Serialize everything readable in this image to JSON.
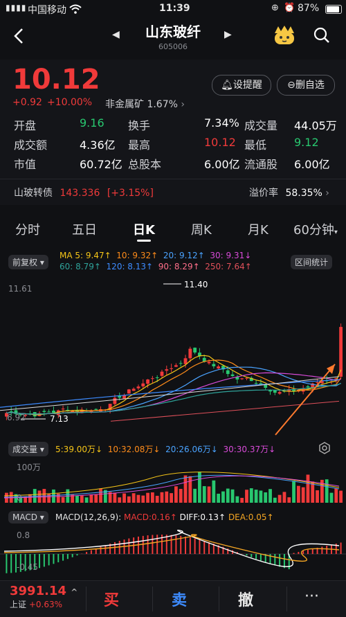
{
  "status": {
    "carrier": "中国移动",
    "time": "11:39",
    "battery": "87%"
  },
  "nav": {
    "title": "山东玻纤",
    "code": "605006"
  },
  "quote": {
    "price": "10.12",
    "change": "+0.92",
    "change_pct": "+10.00%",
    "sector": "非金属矿",
    "sector_pct": "1.67%",
    "alert_label": "设提醒",
    "watch_label": "删自选",
    "rows": [
      [
        {
          "k": "开盘",
          "v": "9.16",
          "c": "green"
        },
        {
          "k": "换手",
          "v": "7.34%",
          "c": "white"
        },
        {
          "k": "成交量",
          "v": "44.05万",
          "c": "white"
        }
      ],
      [
        {
          "k": "成交额",
          "v": "4.36亿",
          "c": "white"
        },
        {
          "k": "最高",
          "v": "10.12",
          "c": "red"
        },
        {
          "k": "最低",
          "v": "9.12",
          "c": "green"
        }
      ],
      [
        {
          "k": "市值",
          "v": "60.72亿",
          "c": "white"
        },
        {
          "k": "总股本",
          "v": "6.00亿",
          "c": "white"
        },
        {
          "k": "流通股",
          "v": "6.00亿",
          "c": "white"
        }
      ]
    ],
    "bond_name": "山玻转债",
    "bond_price": "143.336",
    "bond_pct": "[+3.15%]",
    "premium_label": "溢价率",
    "premium_value": "58.35%"
  },
  "tabs": [
    "分时",
    "五日",
    "日K",
    "周K",
    "月K",
    "60分钟"
  ],
  "kline": {
    "adjust_label": "前复权",
    "stats_label": "区间统计",
    "ma": [
      {
        "t": "MA 5: 9.47↑",
        "color": "#f5c518"
      },
      {
        "t": "10: 9.32↑",
        "color": "#ff8c1a"
      },
      {
        "t": "20: 9.12↑",
        "color": "#4aa3ff"
      },
      {
        "t": "30: 9.31↓",
        "color": "#d94bd9"
      },
      {
        "t": "60: 8.79↑",
        "color": "#2fa39a"
      },
      {
        "t": "120: 8.13↑",
        "color": "#3d8bff"
      },
      {
        "t": "90: 8.29↑",
        "color": "#ff6f8a"
      },
      {
        "t": "250: 7.64↑",
        "color": "#e0505a"
      }
    ],
    "axis_top": "11.61",
    "axis_bottom": "6.92",
    "high_label": "11.40",
    "low_label": "7.13"
  },
  "volume": {
    "label": "成交量",
    "ma": [
      {
        "t": "5:39.00万↓",
        "color": "#f5c518"
      },
      {
        "t": "10:32.08万↓",
        "color": "#ff8c1a"
      },
      {
        "t": "20:26.06万↓",
        "color": "#4aa3ff"
      },
      {
        "t": "30:30.37万↓",
        "color": "#d94bd9"
      }
    ],
    "axis_top": "100万",
    "axis_bottom": "0"
  },
  "macd": {
    "label": "MACD",
    "params": "MACD(12,26,9):",
    "macd": "MACD:0.16↑",
    "diff": "DIFF:0.13↑",
    "dea": "DEA:0.05↑",
    "axis_top": "0.8",
    "axis_bottom": "-0.45"
  },
  "bottom": {
    "index_value": "3991.14",
    "index_name": "上证",
    "index_pct": "+0.63%",
    "buy": "买",
    "sell": "卖",
    "cancel": "撤",
    "more": "···"
  },
  "colors": {
    "up": "#f03a3a",
    "down": "#28c76f",
    "bg": "#101114"
  }
}
